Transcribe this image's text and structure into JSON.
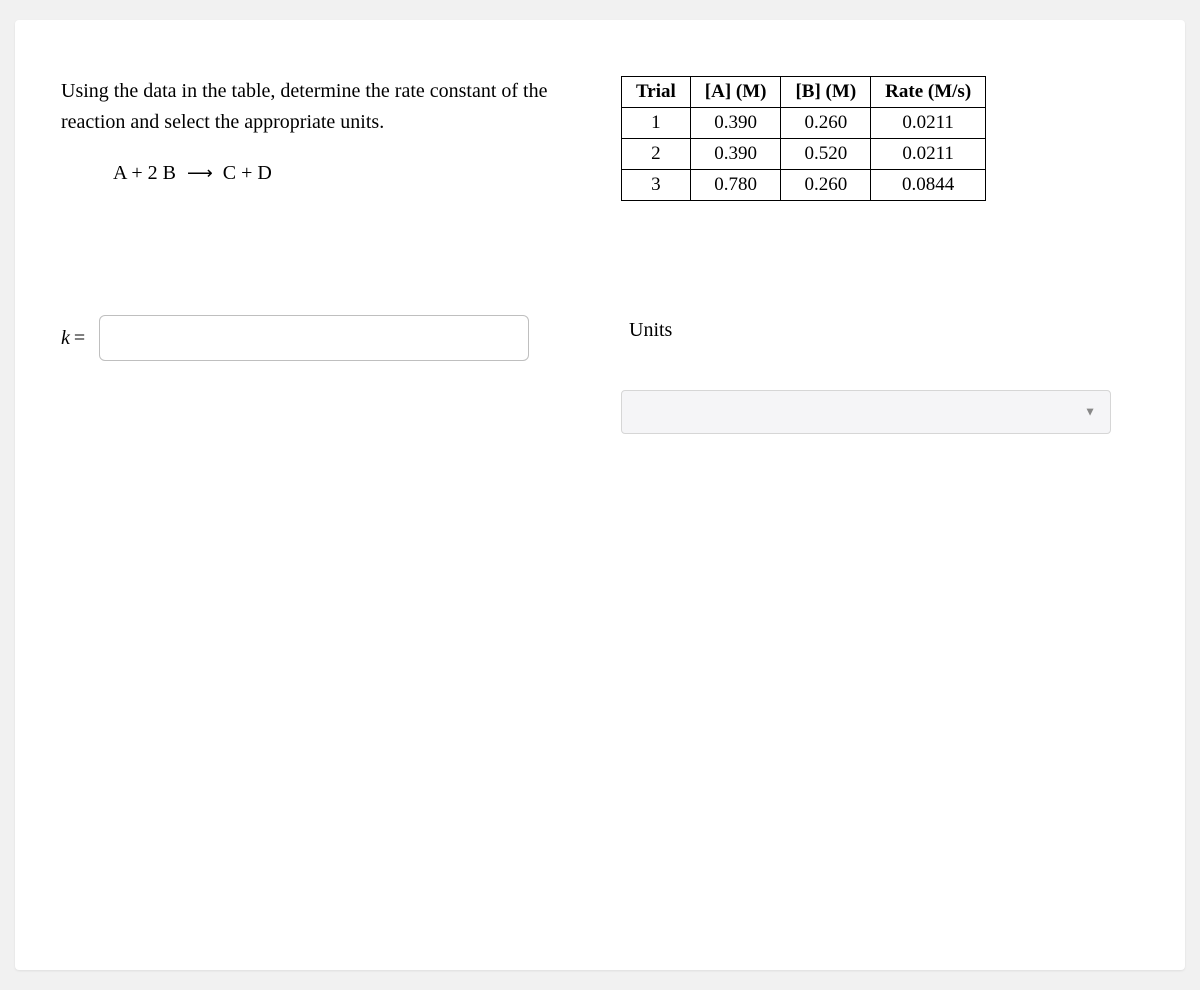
{
  "prompt": "Using the data in the table, determine the rate constant of the reaction and select the appropriate units.",
  "equation": {
    "lhs": "A + 2 B",
    "arrow": "⟶",
    "rhs": "C + D"
  },
  "table": {
    "headers": [
      "Trial",
      "[A] (M)",
      "[B] (M)",
      "Rate (M/s)"
    ],
    "rows": [
      [
        "1",
        "0.390",
        "0.260",
        "0.0211"
      ],
      [
        "2",
        "0.390",
        "0.520",
        "0.0211"
      ],
      [
        "3",
        "0.780",
        "0.260",
        "0.0844"
      ]
    ]
  },
  "answer": {
    "label_k": "k",
    "label_eq": "=",
    "value": ""
  },
  "units": {
    "label": "Units",
    "selected": ""
  }
}
